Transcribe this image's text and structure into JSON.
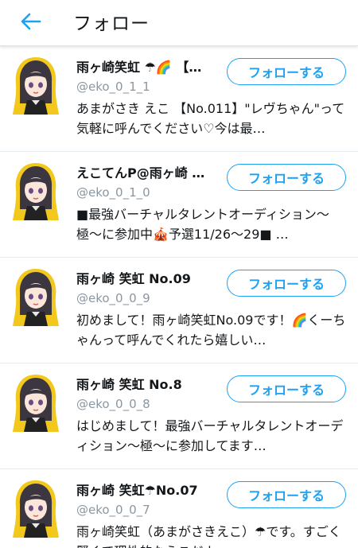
{
  "header": {
    "title": "フォロー"
  },
  "follow_label": "フォローする",
  "users": [
    {
      "name": "雨ヶ崎笑虹 ☂🌈 【…",
      "handle": "@eko_0_1_1",
      "bio": "あまがさき えこ 【No.011】\"レヴちゃん\"って気軽に呼んでください♡今は最…"
    },
    {
      "name": "えこてんP@雨ヶ崎 …",
      "handle": "@eko_0_1_0",
      "bio": "■最強バーチャルタレントオーディション〜極〜に参加中🎪予選11/26〜29■ …"
    },
    {
      "name": "雨ヶ崎 笑虹 No.09",
      "handle": "@eko_0_0_9",
      "bio": "初めまして！雨ヶ崎笑虹No.09です！🌈くーちゃんって呼んでくれたら嬉しい…"
    },
    {
      "name": "雨ヶ崎 笑虹 No.8",
      "handle": "@eko_0_0_8",
      "bio": "はじめまして！最強バーチャルタレントオーディション〜極〜に参加してます…"
    },
    {
      "name": "雨ヶ崎 笑虹☂No.07",
      "handle": "@eko_0_0_7",
      "bio": "雨ヶ崎笑虹（あまがさきえこ）☂です。すごく賢くて理性的なえこだよ"
    }
  ]
}
